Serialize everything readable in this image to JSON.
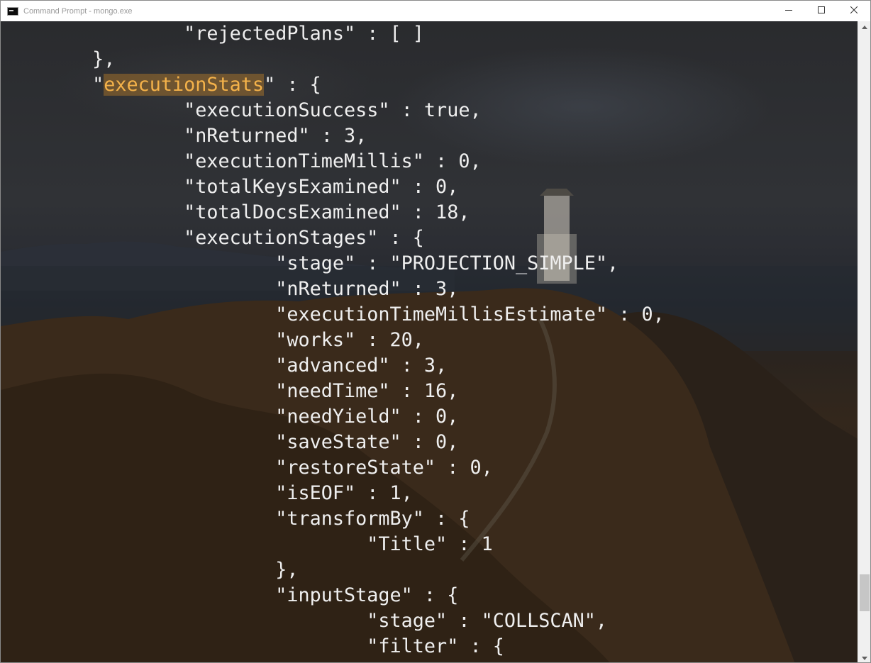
{
  "window": {
    "title": "Command Prompt - mongo.exe",
    "app_icon": "console-icon",
    "controls": [
      "minimize-icon",
      "maximize-icon",
      "close-icon"
    ]
  },
  "scrollbar": {
    "position_fraction": 0.93,
    "thumb_fraction": 0.06
  },
  "console": {
    "lines": [
      {
        "text": "\t\t\"rejectedPlans\" : [ ]"
      },
      {
        "text": "\t},"
      },
      {
        "pre": "\t\"",
        "highlight": "executionStats",
        "post": "\" : {"
      },
      {
        "text": "\t\t\"executionSuccess\" : true,"
      },
      {
        "text": "\t\t\"nReturned\" : 3,"
      },
      {
        "text": "\t\t\"executionTimeMillis\" : 0,"
      },
      {
        "text": "\t\t\"totalKeysExamined\" : 0,"
      },
      {
        "text": "\t\t\"totalDocsExamined\" : 18,"
      },
      {
        "text": "\t\t\"executionStages\" : {"
      },
      {
        "text": "\t\t\t\"stage\" : \"PROJECTION_SIMPLE\","
      },
      {
        "text": "\t\t\t\"nReturned\" : 3,"
      },
      {
        "text": "\t\t\t\"executionTimeMillisEstimate\" : 0,"
      },
      {
        "text": "\t\t\t\"works\" : 20,"
      },
      {
        "text": "\t\t\t\"advanced\" : 3,"
      },
      {
        "text": "\t\t\t\"needTime\" : 16,"
      },
      {
        "text": "\t\t\t\"needYield\" : 0,"
      },
      {
        "text": "\t\t\t\"saveState\" : 0,"
      },
      {
        "text": "\t\t\t\"restoreState\" : 0,"
      },
      {
        "text": "\t\t\t\"isEOF\" : 1,"
      },
      {
        "text": "\t\t\t\"transformBy\" : {"
      },
      {
        "text": "\t\t\t\t\"Title\" : 1"
      },
      {
        "text": "\t\t\t},"
      },
      {
        "text": "\t\t\t\"inputStage\" : {"
      },
      {
        "text": "\t\t\t\t\"stage\" : \"COLLSCAN\","
      },
      {
        "text": "\t\t\t\t\"filter\" : {"
      }
    ]
  }
}
